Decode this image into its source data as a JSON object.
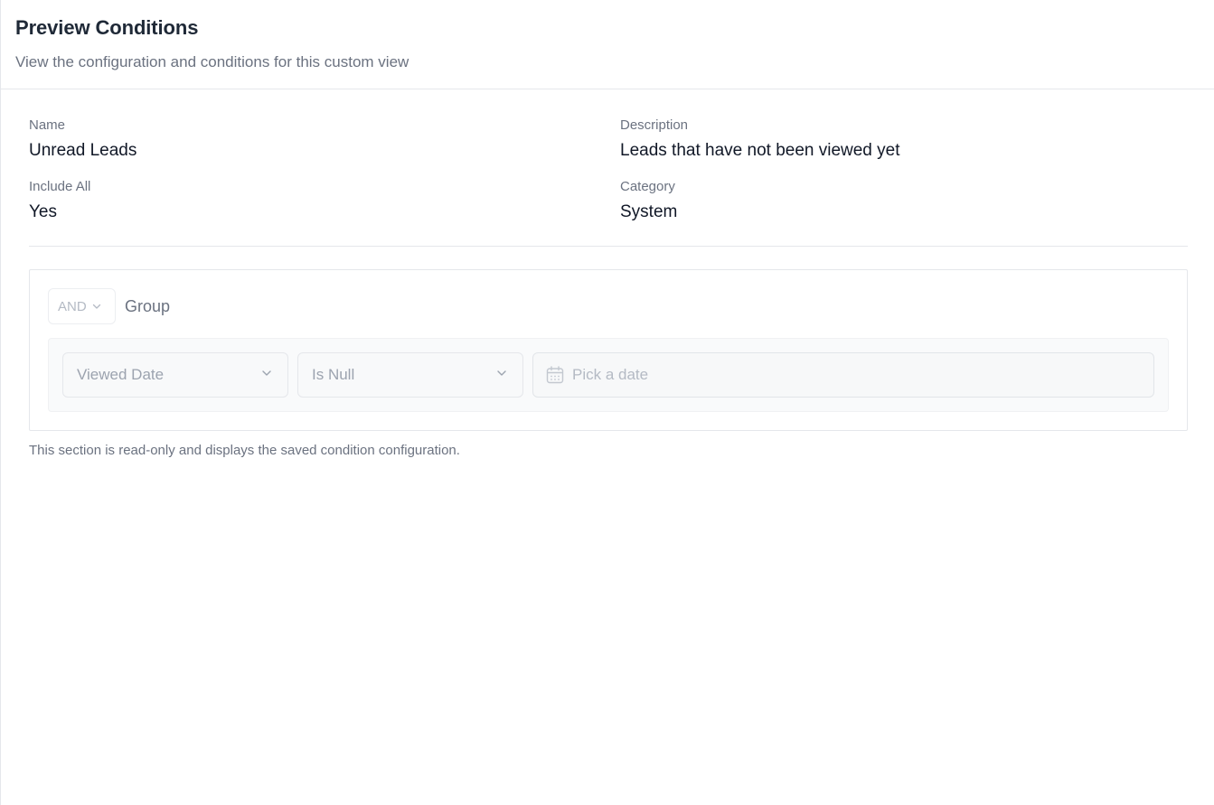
{
  "header": {
    "title": "Preview Conditions",
    "subtitle": "View the configuration and conditions for this custom view"
  },
  "info": {
    "name_label": "Name",
    "name_value": "Unread Leads",
    "description_label": "Description",
    "description_value": "Leads that have not been viewed yet",
    "include_all_label": "Include All",
    "include_all_value": "Yes",
    "category_label": "Category",
    "category_value": "System"
  },
  "conditions": {
    "logic_operator": "AND",
    "group_label": "Group",
    "rules": [
      {
        "field": "Viewed Date",
        "operator": "Is Null",
        "value_placeholder": "Pick a date"
      }
    ],
    "footnote": "This section is read-only and displays the saved condition configuration."
  },
  "icons": {
    "dropdown": "chevron-down-icon",
    "date": "calendar-icon"
  },
  "colors": {
    "title": "#1f2937",
    "muted": "#6b7280",
    "disabled_text": "#9ca3af",
    "border": "#e5e7eb"
  }
}
